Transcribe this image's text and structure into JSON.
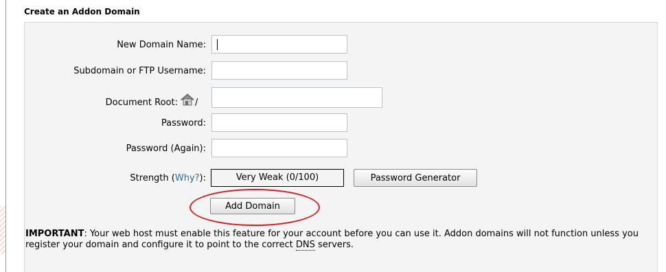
{
  "section": {
    "title": "Create an Addon Domain"
  },
  "form": {
    "new_domain": {
      "label": "New Domain Name:",
      "value": ""
    },
    "subdomain": {
      "label": "Subdomain or FTP Username:",
      "value": ""
    },
    "document_root": {
      "label": "Document Root:",
      "prefix": "/",
      "value": "",
      "icon": "house-icon"
    },
    "password": {
      "label": "Password:",
      "value": ""
    },
    "password_again": {
      "label": "Password (Again):",
      "value": ""
    },
    "strength": {
      "label_before": "Strength (",
      "why_link": "Why?",
      "label_after": "):",
      "value": "Very Weak (0/100)"
    },
    "password_generator_label": "Password Generator",
    "add_domain_label": "Add Domain"
  },
  "note": {
    "important_label": "IMPORTANT",
    "text_1": ": Your web host must enable this feature for your account before you can use it. Addon domains will not function unless you register your domain and configure it to point to the correct ",
    "dns": "DNS",
    "text_2": " servers."
  },
  "colors": {
    "highlight": "#dd1b1b",
    "link": "#2b6f8e",
    "panel_bg": "#f4f4f4"
  }
}
